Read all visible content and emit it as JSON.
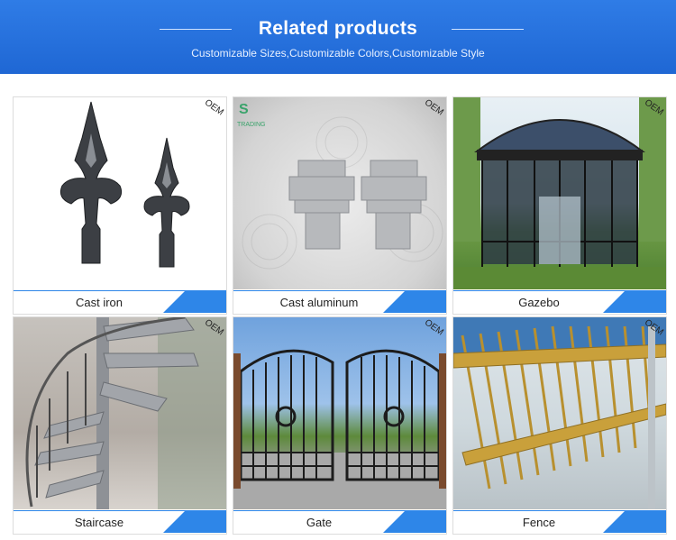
{
  "header": {
    "title": "Related products",
    "subtitle": "Customizable Sizes,Customizable Colors,Customizable Style"
  },
  "colors": {
    "banner": "#1f67d4",
    "accent": "#2e86e8"
  },
  "products": [
    {
      "caption": "Cast iron",
      "oem": "OEM"
    },
    {
      "caption": "Cast aluminum",
      "oem": "OEM",
      "logo_text": "TRADING"
    },
    {
      "caption": "Gazebo",
      "oem": "OEM"
    },
    {
      "caption": "Staircase",
      "oem": "OEM"
    },
    {
      "caption": "Gate",
      "oem": "OEM"
    },
    {
      "caption": "Fence",
      "oem": "OEM"
    }
  ]
}
